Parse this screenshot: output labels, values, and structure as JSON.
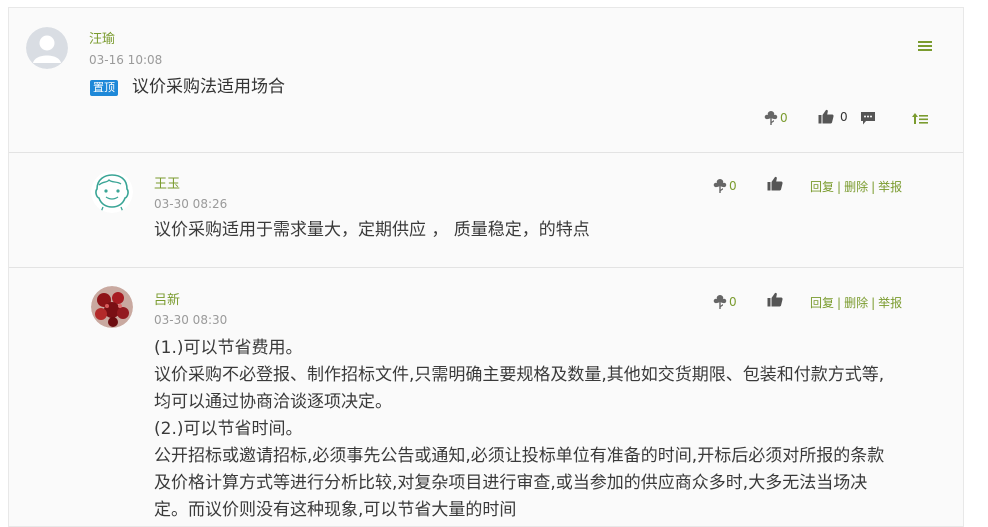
{
  "post": {
    "author": "汪瑜",
    "time": "03-16 10:08",
    "badge": "置顶",
    "title": "议价采购法适用场合",
    "flower_count": "0",
    "like_count": "0"
  },
  "replies": [
    {
      "author": "王玉",
      "time": "03-30 08:26",
      "flower_count": "0",
      "content": [
        "议价采购适用于需求量大，定期供应 ，  质量稳定，的特点"
      ]
    },
    {
      "author": "吕新",
      "time": "03-30 08:30",
      "flower_count": "0",
      "content": [
        "(1.)可以节省费用。",
        "议价采购不必登报、制作招标文件,只需明确主要规格及数量,其他如交货期限、包装和付款方式等,",
        "均可以通过协商洽谈逐项决定。",
        "(2.)可以节省时间。",
        "公开招标或邀请招标,必须事先公告或通知,必须让投标单位有准备的时间,开标后必须对所报的条款",
        "及价格计算方式等进行分析比较,对复杂项目进行审查,或当参加的供应商众多时,大多无法当场决",
        "定。而议价则没有这种现象,可以节省大量的时间"
      ]
    }
  ],
  "links": {
    "reply": "回复",
    "delete": "删除",
    "report": "举报",
    "separator": "|"
  },
  "icons": {
    "menu": "menu-icon",
    "flower": "flower-icon",
    "like": "thumbs-up-icon",
    "comment": "comment-icon",
    "sort": "sort-icon"
  },
  "colors": {
    "accent": "#7a9b2e",
    "badge": "#1e88d8",
    "icon": "#555555"
  }
}
